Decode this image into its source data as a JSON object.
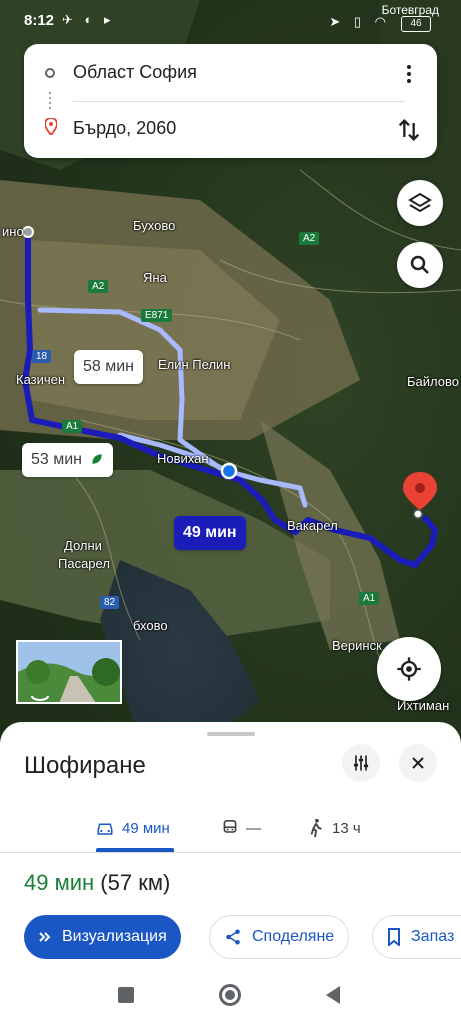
{
  "status_bar": {
    "time": "8:12",
    "carrier": "Ботевград",
    "battery": "46",
    "left_icons": "✈ ◐ ▸",
    "right_icons": "➤ ▯ ◠"
  },
  "search": {
    "origin": "Област София",
    "destination": "Бърдо, 2060"
  },
  "map": {
    "places": {
      "buhovo": "Бухово",
      "yana": "Яна",
      "elin_pelin": "Елин Пелин",
      "kazichene": "Казичен",
      "novihan": "Новихан",
      "vakarel": "Вакарел",
      "dolni_pasarel_1": "Долни",
      "dolni_pasarel_2": "Пасарел",
      "baylovo": "Байлово",
      "verinsko": "Веринск",
      "ihtiman": "Ихтиман",
      "bukovo": "бхово",
      "sofia_edge": "ино"
    },
    "roads": {
      "a2_top": "A2",
      "a2_left": "A2",
      "e871": "E871",
      "r18": "18",
      "a1_left": "A1",
      "a1_right": "A1",
      "r82": "82"
    },
    "route_bubbles": {
      "alt1": "58 мин",
      "alt2": "53 мин",
      "selected": "49 мин"
    },
    "colors": {
      "route_selected": "#1a1db8",
      "route_alt": "#a8b9ff",
      "destination_pin": "#e94235"
    }
  },
  "sheet": {
    "title": "Шофиране",
    "tabs": [
      {
        "label": "49 мин",
        "icon": "car-icon"
      },
      {
        "label": "—",
        "icon": "train-icon"
      },
      {
        "label": "13 ч",
        "icon": "walk-icon"
      }
    ],
    "summary_time": "49 мин",
    "summary_distance": "(57 км)",
    "actions": {
      "preview": "Визуализация",
      "share": "Споделяне",
      "save": "Запаз"
    }
  }
}
